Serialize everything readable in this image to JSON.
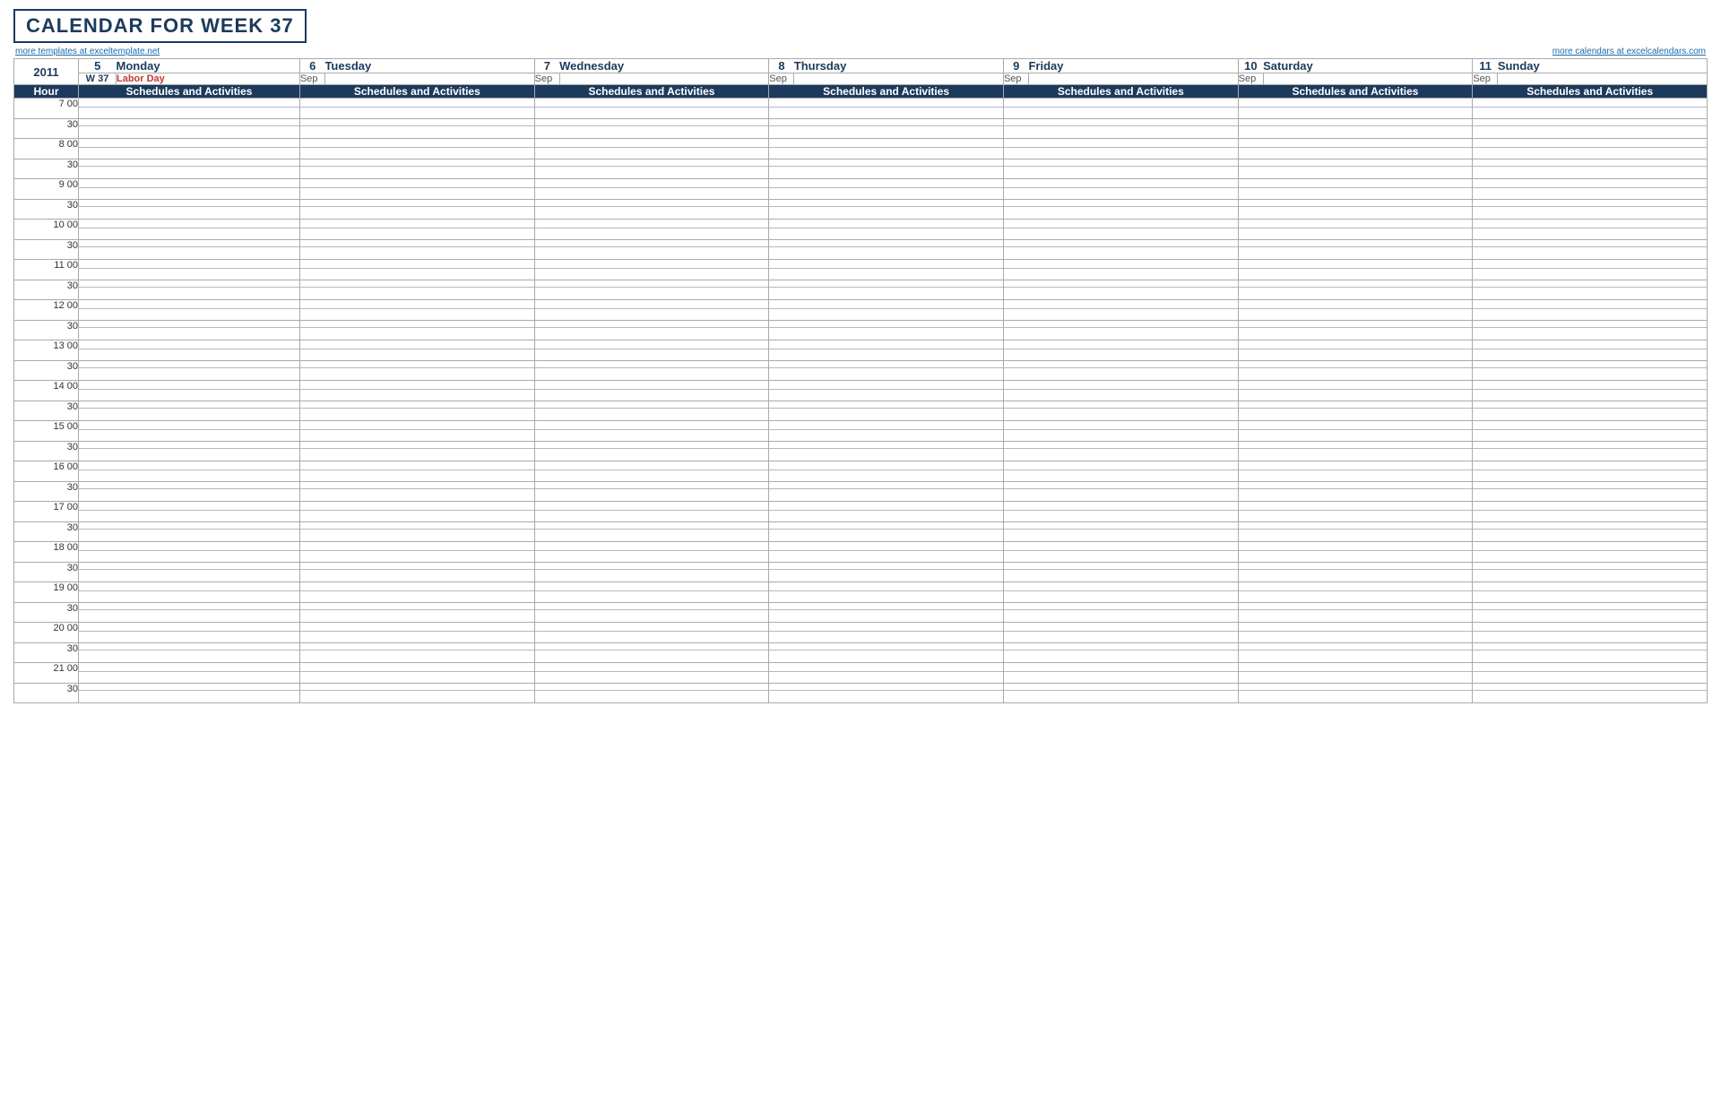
{
  "header": {
    "title": "CALENDAR FOR WEEK 37",
    "link_left": "more templates at exceltemplate.net",
    "link_right": "more calendars at excelcalendars.com"
  },
  "calendar": {
    "year": "2011",
    "week": "W 37",
    "days": [
      {
        "num": "5",
        "name": "Monday",
        "month": "Sep",
        "note": "Labor Day"
      },
      {
        "num": "6",
        "name": "Tuesday",
        "month": "Sep",
        "note": ""
      },
      {
        "num": "7",
        "name": "Wednesday",
        "month": "Sep",
        "note": ""
      },
      {
        "num": "8",
        "name": "Thursday",
        "month": "Sep",
        "note": ""
      },
      {
        "num": "9",
        "name": "Friday",
        "month": "Sep",
        "note": ""
      },
      {
        "num": "10",
        "name": "Saturday",
        "month": "Sep",
        "note": ""
      },
      {
        "num": "11",
        "name": "Sunday",
        "month": "Sep",
        "note": ""
      }
    ],
    "hour_label": "Hour",
    "schedules_label": "Schedules and Activities",
    "hours": [
      "7",
      "8",
      "9",
      "10",
      "11",
      "12",
      "13",
      "14",
      "15",
      "16",
      "17",
      "18",
      "19",
      "20",
      "21"
    ]
  }
}
